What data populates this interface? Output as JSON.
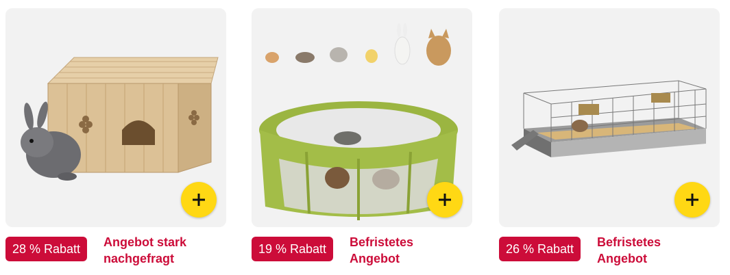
{
  "products": [
    {
      "image_alt": "Wooden rabbit hutch with grey rabbit",
      "discount_label": "28 % Rabatt",
      "deal_label": "Angebot stark\nnachgefragt",
      "add_icon": "plus-icon"
    },
    {
      "image_alt": "Green pop-up playpen with small pets",
      "discount_label": "19 % Rabatt",
      "deal_label": "Befristetes\nAngebot",
      "add_icon": "plus-icon"
    },
    {
      "image_alt": "Long wire rabbit cage with ramp",
      "discount_label": "26 % Rabatt",
      "deal_label": "Befristetes\nAngebot",
      "add_icon": "plus-icon"
    }
  ],
  "colors": {
    "badge": "#cc0c39",
    "deal_text": "#cc0c39",
    "add_button": "#ffd814",
    "image_bg": "#f2f2f2"
  }
}
